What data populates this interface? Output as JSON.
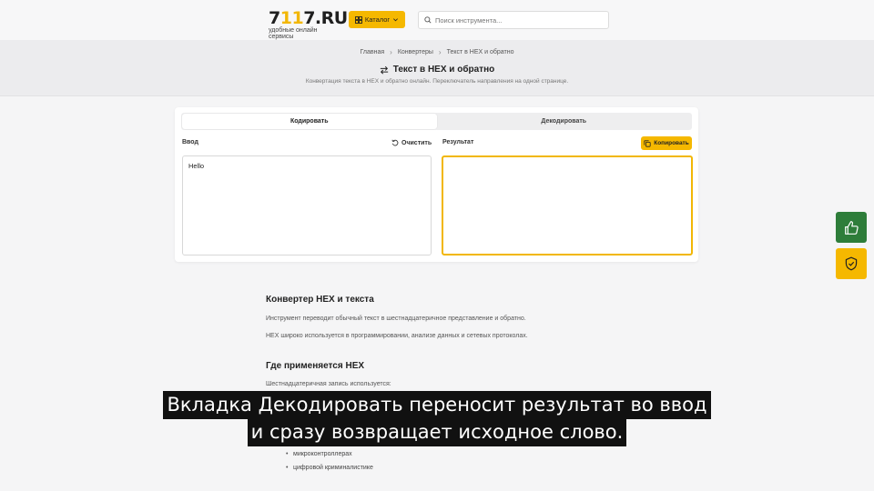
{
  "header": {
    "logo_prefix": "7",
    "logo_accent": "11",
    "logo_suffix": "7.RU",
    "logo_tagline": "удобные онлайн сервисы",
    "catalog_label": "Каталог",
    "search_placeholder": "Поиск инструмента..."
  },
  "breadcrumb": [
    "Главная",
    "Конвертеры",
    "Текст в HEX и обратно"
  ],
  "page": {
    "title": "Текст в HEX и обратно",
    "description": "Конвертация текста в HEX и обратно онлайн. Переключатель направления на одной странице."
  },
  "tool": {
    "tabs": [
      {
        "label": "Кодировать",
        "active": true
      },
      {
        "label": "Декодировать",
        "active": false
      }
    ],
    "input_label": "Ввод",
    "clear_label": "Очистить",
    "output_label": "Результат",
    "copy_label": "Копировать",
    "input_value": "Hello",
    "output_value": ""
  },
  "floating": {
    "like_icon": "thumbs-up-icon",
    "shield_icon": "shield-check-icon"
  },
  "article": {
    "h1": "Конвертер HEX и текста",
    "p1": "Инструмент переводит обычный текст в шестнадцатеричное представление и обратно.",
    "p2": "HEX широко используется в программировании, анализе данных и сетевых протоколах.",
    "h2": "Где применяется HEX",
    "p3": "Шестнадцатеричная запись используется:",
    "list": [
      "микроконтроллерах",
      "цифровой криминалистике"
    ]
  },
  "subtitle": {
    "line1": "Вкладка Декодировать переносит результат во ввод",
    "line2": "и сразу возвращает исходное слово."
  },
  "colors": {
    "accent": "#f5b800",
    "like": "#2e7d3a"
  }
}
